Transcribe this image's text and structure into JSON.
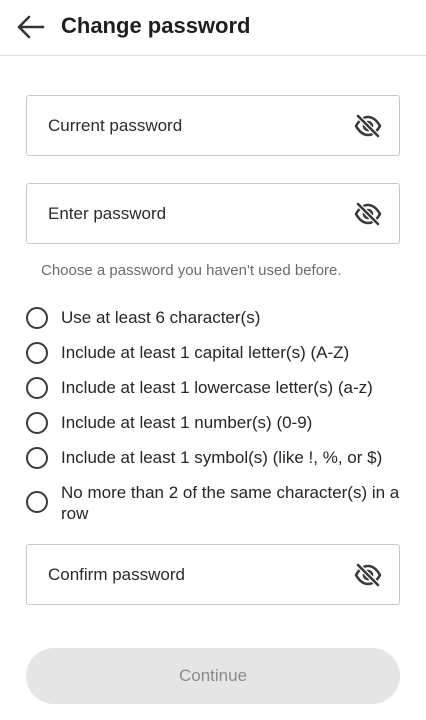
{
  "header": {
    "title": "Change password",
    "back_icon": "arrow-left-icon"
  },
  "fields": {
    "current": {
      "label": "Current password",
      "icon": "eye-slash-icon"
    },
    "new": {
      "label": "Enter password",
      "icon": "eye-slash-icon"
    },
    "confirm": {
      "label": "Confirm password",
      "icon": "eye-slash-icon"
    }
  },
  "helper_text": "Choose a password you haven't used before.",
  "requirements": [
    "Use at least 6 character(s)",
    "Include at least 1 capital letter(s) (A-Z)",
    "Include at least 1 lowercase letter(s) (a-z)",
    "Include at least 1 number(s) (0-9)",
    "Include at least 1 symbol(s) (like !, %, or $)",
    "No more than 2 of the same character(s) in a row"
  ],
  "continue_label": "Continue",
  "colors": {
    "disabled_button_bg": "#e5e5e5",
    "disabled_button_text": "#8a8a8a"
  }
}
